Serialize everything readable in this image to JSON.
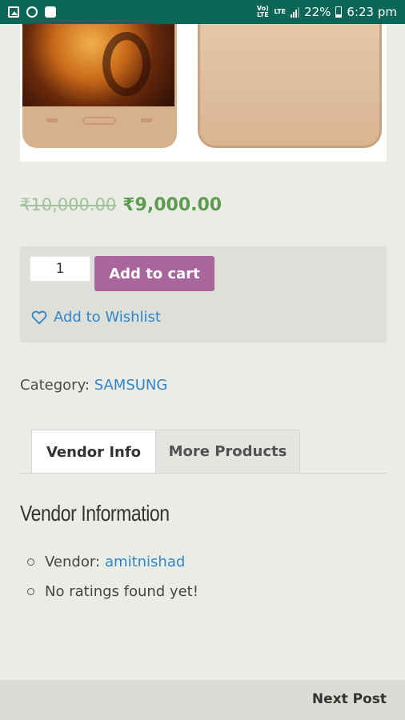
{
  "status_bar": {
    "left_icons": [
      "image-icon",
      "google-icon",
      "message-icon"
    ],
    "network_1": "Vo) LTE",
    "network_2": "LTE",
    "battery": "22%",
    "time": "6:23 pm"
  },
  "product": {
    "price_old": "₹10,000.00",
    "price_new": "₹9,000.00",
    "quantity": "1",
    "add_to_cart_label": "Add to cart",
    "wishlist_label": "Add to Wishlist",
    "category_label": "Category:",
    "category_value": "SAMSUNG"
  },
  "tabs": {
    "vendor_info": "Vendor Info",
    "more_products": "More Products"
  },
  "vendor": {
    "title": "Vendor Information",
    "vendor_label": "Vendor:",
    "vendor_name": "amitnishad",
    "ratings_text": "No ratings found yet!"
  },
  "footer": {
    "next_post": "Next Post"
  },
  "colors": {
    "status_bar": "#0b6658",
    "button": "#a8669c",
    "price_new": "#5d9c4f",
    "link": "#2f86c6"
  }
}
